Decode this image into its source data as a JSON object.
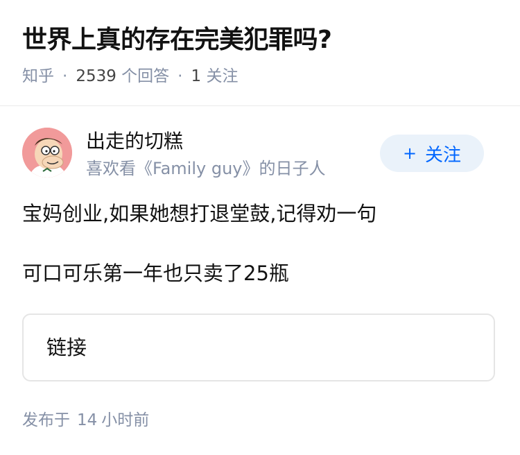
{
  "question": {
    "title": "世界上真的存在完美犯罪吗?",
    "source": "知乎",
    "answer_count": "2539",
    "answer_label": "个回答",
    "follow_count": "1",
    "follow_label": "关注"
  },
  "author": {
    "name": "出走的切糕",
    "bio": "喜欢看《Family guy》的日子人",
    "avatar_icon": "cartoon-avatar-icon",
    "follow_button": {
      "plus": "+",
      "label": "关注"
    }
  },
  "answer": {
    "paragraphs": [
      "宝妈创业,如果她想打退堂鼓,记得劝一句",
      "可口可乐第一年也只卖了25瓶"
    ],
    "link_card_label": "链接"
  },
  "footer": {
    "published_prefix": "发布于",
    "time_number": "14",
    "time_unit": "小时前"
  },
  "colors": {
    "accent": "#0066ff",
    "follow_bg": "#eaf2fa",
    "muted": "#8590a6",
    "avatar_bg": "#f19a9a"
  }
}
